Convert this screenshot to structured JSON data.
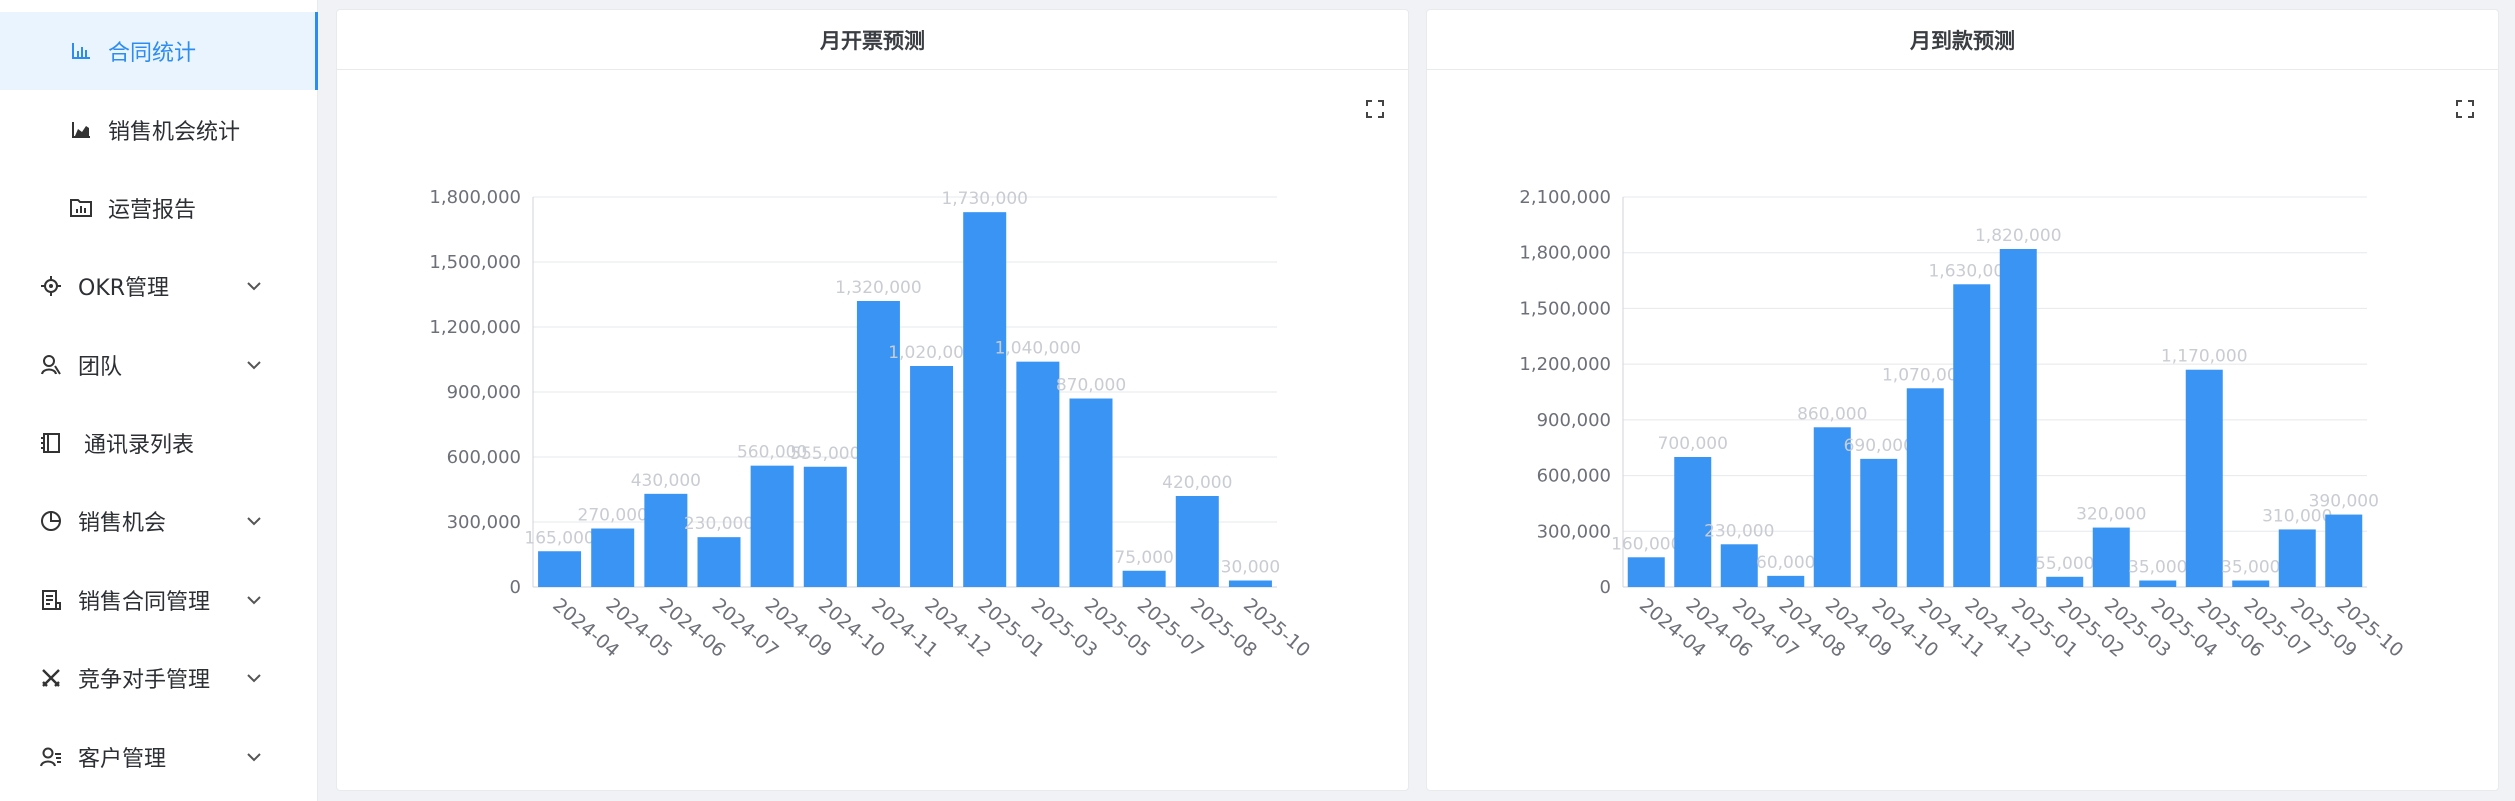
{
  "sidebar": {
    "items": [
      {
        "label": "合同统计",
        "icon": "bar-chart-icon",
        "active": true,
        "sub": true
      },
      {
        "label": "销售机会统计",
        "icon": "area-chart-icon",
        "sub": true
      },
      {
        "label": "运营报告",
        "icon": "report-folder-icon",
        "sub": true
      },
      {
        "label": "OKR管理",
        "icon": "target-icon",
        "expandable": true
      },
      {
        "label": "团队",
        "icon": "team-icon",
        "expandable": true
      },
      {
        "label": "通讯录列表",
        "icon": "address-book-icon"
      },
      {
        "label": "销售机会",
        "icon": "pie-chart-icon",
        "expandable": true
      },
      {
        "label": "销售合同管理",
        "icon": "contract-icon",
        "expandable": true
      },
      {
        "label": "竞争对手管理",
        "icon": "swords-icon",
        "expandable": true
      },
      {
        "label": "客户管理",
        "icon": "customer-icon",
        "expandable": true
      }
    ]
  },
  "colors": {
    "accent": "#2d8cf0",
    "bar": "#3a94f4"
  },
  "chart_data": [
    {
      "type": "bar",
      "title": "月开票预测",
      "categories": [
        "2024-04",
        "2024-05",
        "2024-06",
        "2024-07",
        "2024-09",
        "2024-10",
        "2024-11",
        "2024-12",
        "2025-01",
        "2025-03",
        "2025-05",
        "2025-07",
        "2025-08",
        "2025-10"
      ],
      "values": [
        165000,
        270000,
        430000,
        230000,
        560000,
        555000,
        1320000,
        1020000,
        1730000,
        1040000,
        870000,
        75000,
        420000,
        30000
      ],
      "yticks": [
        "0",
        "300,000",
        "600,000",
        "900,000",
        "1,200,000",
        "1,500,000",
        "1,800,000"
      ],
      "ylim": [
        0,
        1800000
      ],
      "grid": true
    },
    {
      "type": "bar",
      "title": "月到款预测",
      "categories": [
        "2024-04",
        "2024-06",
        "2024-07",
        "2024-08",
        "2024-09",
        "2024-10",
        "2024-11",
        "2024-12",
        "2025-01",
        "2025-02",
        "2025-03",
        "2025-04",
        "2025-06",
        "2025-07",
        "2025-09",
        "2025-10"
      ],
      "values": [
        160000,
        700000,
        230000,
        60000,
        860000,
        690000,
        1070000,
        1630000,
        1820000,
        55000,
        320000,
        35000,
        1170000,
        35000,
        310000,
        390000
      ],
      "yticks": [
        "0",
        "300,000",
        "600,000",
        "900,000",
        "1,200,000",
        "1,500,000",
        "1,800,000",
        "2,100,000"
      ],
      "ylim": [
        0,
        2100000
      ],
      "grid": true
    }
  ]
}
